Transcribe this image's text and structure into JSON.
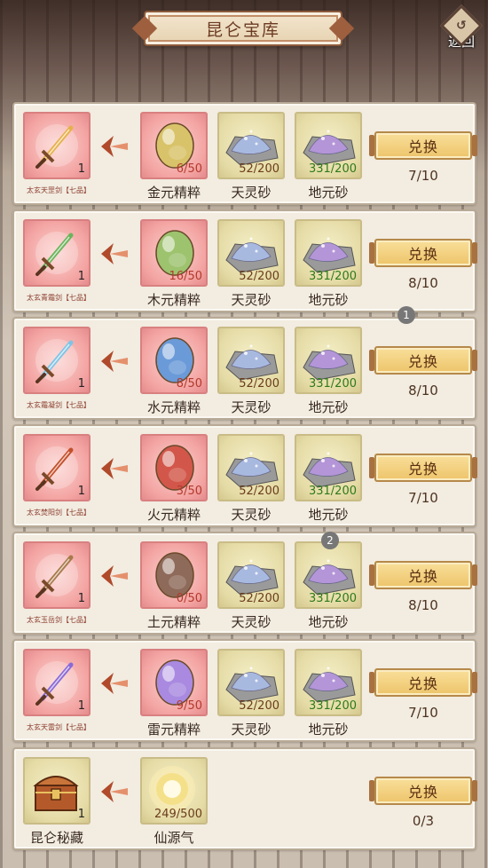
{
  "header": {
    "title": "昆仑宝库",
    "back_label": "返回"
  },
  "rows": [
    {
      "result": {
        "name": "太玄天罡剑【七品】",
        "count": "1",
        "color": "#e6b14a"
      },
      "materials": [
        {
          "name": "金元精粹",
          "count": "6/50",
          "color": "#d9c36a"
        },
        {
          "name": "天灵砂",
          "count": "52/200",
          "color": "#a8b9e0"
        },
        {
          "name": "地元砂",
          "count": "331/200",
          "color": "#b495d8"
        }
      ],
      "button": "兑换",
      "limit": "7/10"
    },
    {
      "result": {
        "name": "太玄青霜剑【七品】",
        "count": "1",
        "color": "#6ab45a"
      },
      "materials": [
        {
          "name": "木元精粹",
          "count": "16/50",
          "color": "#9dc36e"
        },
        {
          "name": "天灵砂",
          "count": "52/200",
          "color": "#a8b9e0"
        },
        {
          "name": "地元砂",
          "count": "331/200",
          "color": "#b495d8"
        }
      ],
      "button": "兑换",
      "limit": "8/10"
    },
    {
      "result": {
        "name": "太玄霜凝剑【七品】",
        "count": "1",
        "color": "#7fc4e6"
      },
      "materials": [
        {
          "name": "水元精粹",
          "count": "8/50",
          "color": "#6a9ad8"
        },
        {
          "name": "天灵砂",
          "count": "52/200",
          "color": "#a8b9e0"
        },
        {
          "name": "地元砂",
          "count": "331/200",
          "color": "#b495d8"
        }
      ],
      "button": "兑换",
      "limit": "8/10"
    },
    {
      "result": {
        "name": "太玄焚阳剑【七品】",
        "count": "1",
        "color": "#c4502a"
      },
      "materials": [
        {
          "name": "火元精粹",
          "count": "3/50",
          "color": "#d2574a"
        },
        {
          "name": "天灵砂",
          "count": "52/200",
          "color": "#a8b9e0"
        },
        {
          "name": "地元砂",
          "count": "331/200",
          "color": "#b495d8"
        }
      ],
      "button": "兑换",
      "limit": "7/10"
    },
    {
      "result": {
        "name": "太玄玉岳剑【七品】",
        "count": "1",
        "color": "#a87a4a"
      },
      "materials": [
        {
          "name": "土元精粹",
          "count": "0/50",
          "color": "#8e6a5a"
        },
        {
          "name": "天灵砂",
          "count": "52/200",
          "color": "#a8b9e0"
        },
        {
          "name": "地元砂",
          "count": "331/200",
          "color": "#b495d8"
        }
      ],
      "button": "兑换",
      "limit": "8/10"
    },
    {
      "result": {
        "name": "太玄天雷剑【七品】",
        "count": "1",
        "color": "#8a6ad8"
      },
      "materials": [
        {
          "name": "雷元精粹",
          "count": "9/50",
          "color": "#a98ae0"
        },
        {
          "name": "天灵砂",
          "count": "52/200",
          "color": "#a8b9e0"
        },
        {
          "name": "地元砂",
          "count": "331/200",
          "color": "#b495d8"
        }
      ],
      "button": "兑换",
      "limit": "7/10"
    },
    {
      "result": {
        "name": "昆仑秘藏",
        "count": "1",
        "color": "#b45a2a"
      },
      "materials": [
        {
          "name": "仙源气",
          "count": "249/500",
          "color": "#f5e08a"
        }
      ],
      "button": "兑换",
      "limit": "0/3"
    }
  ],
  "badges": [
    "1",
    "2"
  ]
}
